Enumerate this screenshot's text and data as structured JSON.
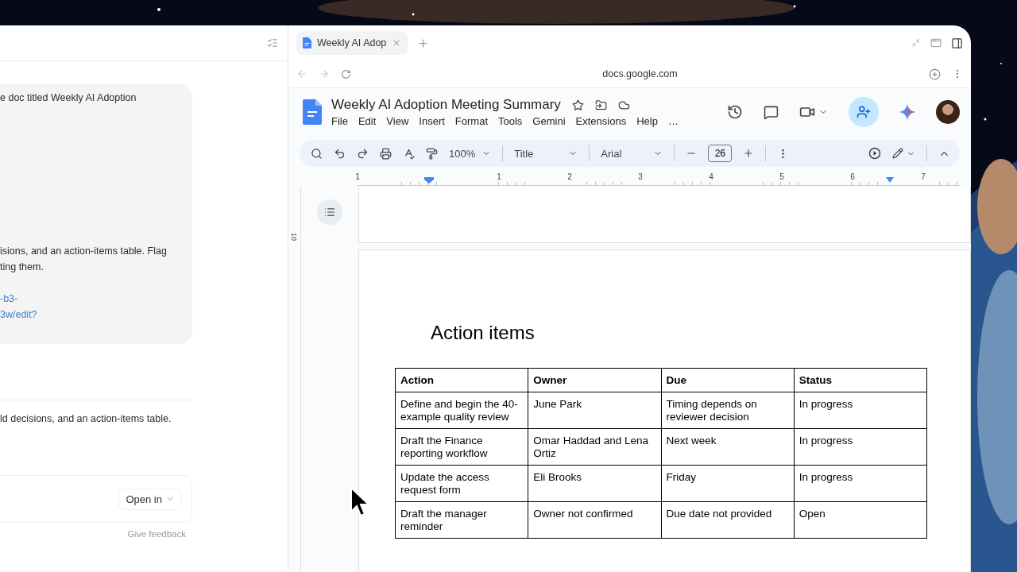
{
  "chat": {
    "bubble_lines": [
      "e doc titled Weekly AI Adoption",
      "isions, and an action-items table. Flag",
      "ting them."
    ],
    "link_lines": [
      "-b3-",
      "3w/edit?"
    ],
    "reply": "ld decisions, and an action-items table.",
    "open_button": "Open in",
    "feedback": "Give feedback"
  },
  "browser": {
    "tabs": [
      {
        "title": "Weekly AI Adop",
        "selected": true
      }
    ],
    "address": "docs.google.com"
  },
  "doc": {
    "title": "Weekly AI Adoption Meeting Summary",
    "menu": [
      "File",
      "Edit",
      "View",
      "Insert",
      "Format",
      "Tools",
      "Gemini",
      "Extensions",
      "Help",
      "…"
    ],
    "toolbar": {
      "zoom": "100%",
      "style": "Title",
      "font": "Arial",
      "size": "26"
    },
    "ruler": [
      "1",
      "1",
      "2",
      "3",
      "4",
      "5",
      "6",
      "7"
    ],
    "vertical_ruler": "10",
    "heading": "Action items",
    "table": {
      "columns": [
        "Action",
        "Owner",
        "Due",
        "Status"
      ],
      "rows": [
        [
          "Define and begin the 40-example quality review",
          "June Park",
          "Timing depends on reviewer decision",
          "In progress"
        ],
        [
          "Draft the Finance reporting workflow",
          "Omar Haddad and Lena Ortiz",
          "Next week",
          "In progress"
        ],
        [
          "Update the access request form",
          "Eli Brooks",
          "Friday",
          "In progress"
        ],
        [
          "Draft the manager reminder",
          "Owner not confirmed",
          "Due date not provided",
          "Open"
        ]
      ]
    }
  }
}
